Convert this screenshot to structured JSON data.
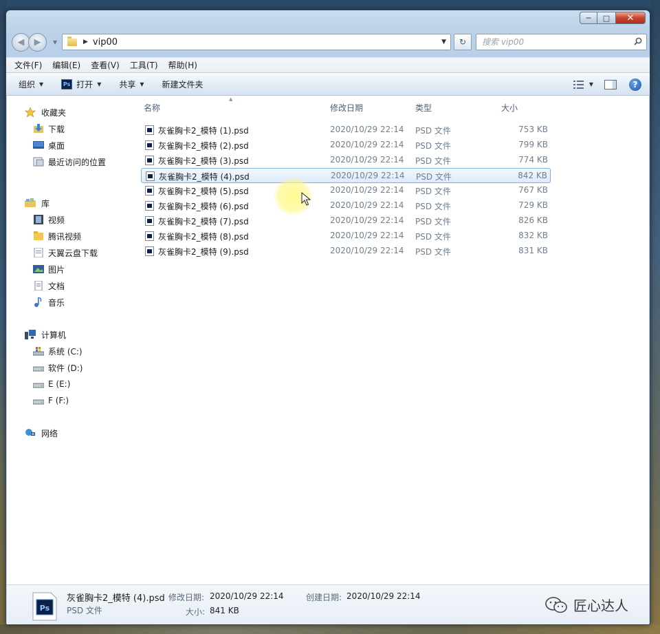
{
  "window": {
    "caption_buttons": {
      "minimize": "─",
      "maximize": "□",
      "close": "✕"
    }
  },
  "navigation": {
    "back_icon": "◀",
    "forward_icon": "▶",
    "address_path": "vip00",
    "search_placeholder": "搜索 vip00"
  },
  "menu": [
    "文件(F)",
    "编辑(E)",
    "查看(V)",
    "工具(T)",
    "帮助(H)"
  ],
  "toolbar": {
    "organize": "组织",
    "open": "打开",
    "share": "共享",
    "new_folder": "新建文件夹",
    "ps_badge": "Ps",
    "help": "?"
  },
  "sidebar": {
    "favorites": {
      "label": "收藏夹",
      "items": [
        "下载",
        "桌面",
        "最近访问的位置"
      ]
    },
    "libraries": {
      "label": "库",
      "items": [
        "视频",
        "腾讯视频",
        "天翼云盘下载",
        "图片",
        "文档",
        "音乐"
      ]
    },
    "computer": {
      "label": "计算机",
      "items": [
        "系统 (C:)",
        "软件 (D:)",
        "E (E:)",
        "F (F:)"
      ]
    },
    "network": {
      "label": "网络"
    }
  },
  "columns": {
    "name": "名称",
    "date": "修改日期",
    "type": "类型",
    "size": "大小"
  },
  "files": [
    {
      "name": "灰雀胸卡2_模特 (1).psd",
      "date": "2020/10/29 22:14",
      "type": "PSD 文件",
      "size": "753 KB"
    },
    {
      "name": "灰雀胸卡2_模特 (2).psd",
      "date": "2020/10/29 22:14",
      "type": "PSD 文件",
      "size": "799 KB"
    },
    {
      "name": "灰雀胸卡2_模特 (3).psd",
      "date": "2020/10/29 22:14",
      "type": "PSD 文件",
      "size": "774 KB"
    },
    {
      "name": "灰雀胸卡2_模特 (4).psd",
      "date": "2020/10/29 22:14",
      "type": "PSD 文件",
      "size": "842 KB"
    },
    {
      "name": "灰雀胸卡2_模特 (5).psd",
      "date": "2020/10/29 22:14",
      "type": "PSD 文件",
      "size": "767 KB"
    },
    {
      "name": "灰雀胸卡2_模特 (6).psd",
      "date": "2020/10/29 22:14",
      "type": "PSD 文件",
      "size": "729 KB"
    },
    {
      "name": "灰雀胸卡2_模特 (7).psd",
      "date": "2020/10/29 22:14",
      "type": "PSD 文件",
      "size": "826 KB"
    },
    {
      "name": "灰雀胸卡2_模特 (8).psd",
      "date": "2020/10/29 22:14",
      "type": "PSD 文件",
      "size": "832 KB"
    },
    {
      "name": "灰雀胸卡2_模特 (9).psd",
      "date": "2020/10/29 22:14",
      "type": "PSD 文件",
      "size": "831 KB"
    }
  ],
  "details": {
    "icon_text": "Ps",
    "name": "灰雀胸卡2_模特 (4).psd",
    "type": "PSD 文件",
    "modified_label": "修改日期:",
    "modified_value": "2020/10/29 22:14",
    "created_label": "创建日期:",
    "created_value": "2020/10/29 22:14",
    "size_label": "大小:",
    "size_value": "841 KB"
  },
  "watermark": "匠心达人",
  "colors": {
    "selection_border": "#84acdd",
    "selection_fill": "#dcebfc",
    "ps_blue": "#0b2146"
  }
}
